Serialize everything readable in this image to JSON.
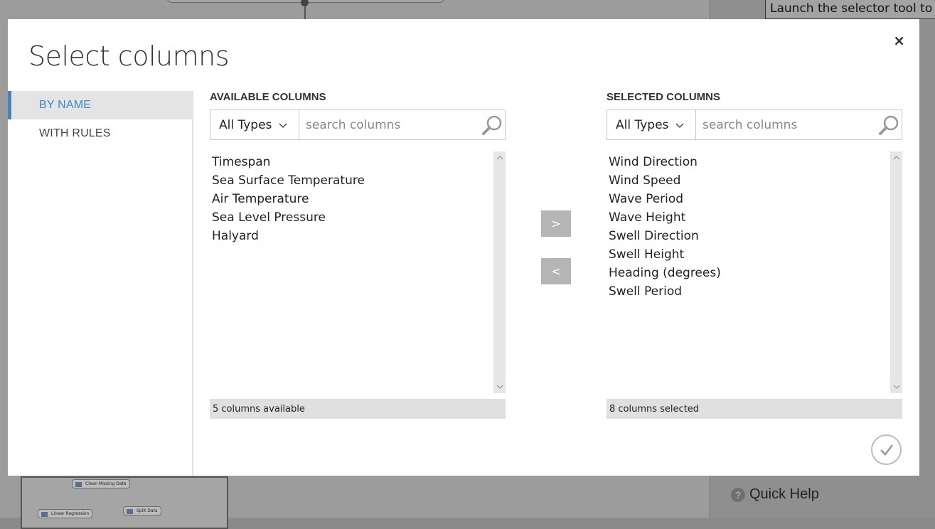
{
  "background": {
    "selector_hint": "Launch the selector tool to m",
    "minimap_nodes": [
      "Clean Missing Data",
      "Linear Regression",
      "Split Data"
    ],
    "quick_help": "Quick Help",
    "quick_help_icon": "?"
  },
  "dialog": {
    "title": "Select columns",
    "close_glyph": "×",
    "confirm_icon": "checkmark-icon"
  },
  "nav": {
    "items": [
      {
        "label": "BY NAME",
        "active": true
      },
      {
        "label": "WITH RULES",
        "active": false
      }
    ]
  },
  "available": {
    "heading": "AVAILABLE COLUMNS",
    "type_filter": "All Types",
    "search_placeholder": "search columns",
    "items": [
      "Timespan",
      "Sea Surface Temperature",
      "Air Temperature",
      "Sea Level Pressure",
      "Halyard"
    ],
    "status": "5 columns available"
  },
  "selected": {
    "heading": "SELECTED COLUMNS",
    "type_filter": "All Types",
    "search_placeholder": "search columns",
    "items": [
      "Wind Direction",
      "Wind Speed",
      "Wave Period",
      "Wave Height",
      "Swell Direction",
      "Swell Height",
      "Heading (degrees)",
      "Swell Period"
    ],
    "status": "8 columns selected"
  },
  "actions": {
    "add_label": ">",
    "remove_label": "<"
  },
  "colors": {
    "accent": "#3a87c8",
    "button_gray": "#b5b5b5",
    "overlay": "#8a8a8a"
  }
}
